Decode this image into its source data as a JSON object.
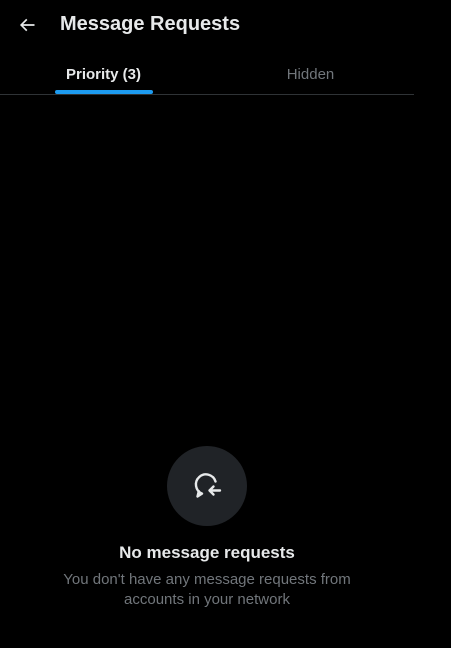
{
  "header": {
    "back_icon": "arrow-left-icon",
    "title": "Message Requests"
  },
  "tabs": [
    {
      "label": "Priority (3)",
      "active": true
    },
    {
      "label": "Hidden",
      "active": false
    }
  ],
  "empty_state": {
    "icon": "message-request-icon",
    "title": "No message requests",
    "description": "You don't have any message requests from accounts in your network"
  },
  "colors": {
    "background": "#000000",
    "primary_text": "#e7e9ea",
    "secondary_text": "#71767b",
    "accent": "#1d9bf0",
    "divider": "#2f3336",
    "icon_circle": "#202327"
  }
}
